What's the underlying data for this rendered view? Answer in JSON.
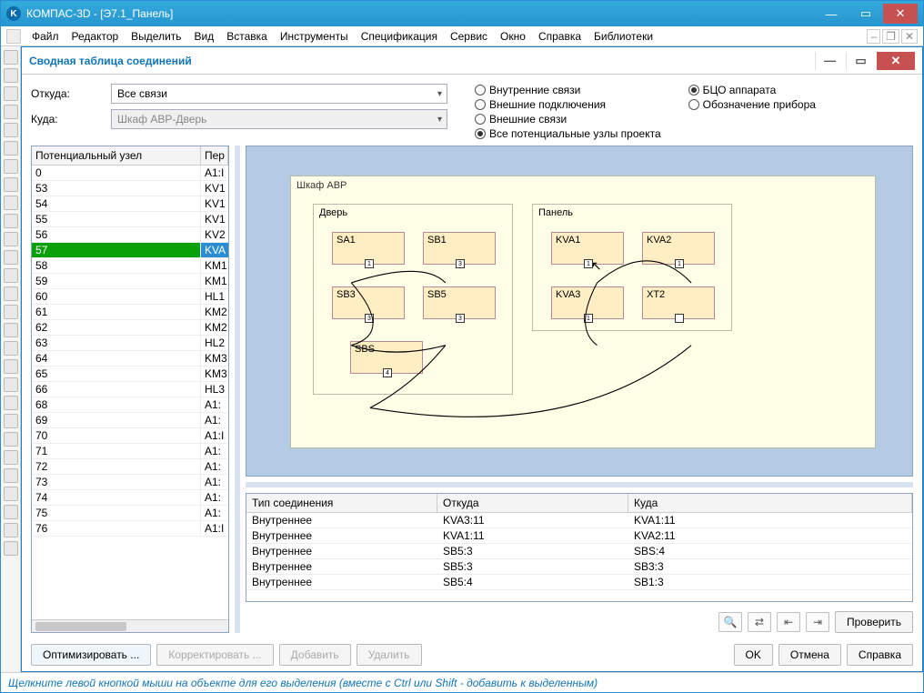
{
  "outer": {
    "app_icon": "K",
    "title": "КОМПАС-3D - [Э7.1_Панель]"
  },
  "menu": [
    "Файл",
    "Редактор",
    "Выделить",
    "Вид",
    "Вставка",
    "Инструменты",
    "Спецификация",
    "Сервис",
    "Окно",
    "Справка",
    "Библиотеки"
  ],
  "dialog": {
    "title": "Сводная таблица соединений",
    "from_label": "Откуда:",
    "to_label": "Куда:",
    "from_value": "Все связи",
    "to_value": "Шкаф АВР-Дверь",
    "radios1": [
      "Внутренние связи",
      "Внешние подключения",
      "Внешние связи",
      "Все потенциальные узлы проекта"
    ],
    "radios1_checked": 3,
    "radios2": [
      "БЦО аппарата",
      "Обозначение прибора"
    ],
    "radios2_checked": 0
  },
  "left_table": {
    "h1": "Потенциальный узел",
    "h2": "Пер",
    "rows": [
      {
        "a": "0",
        "b": "A1:I"
      },
      {
        "a": "53",
        "b": "KV1"
      },
      {
        "a": "54",
        "b": "KV1"
      },
      {
        "a": "55",
        "b": "KV1"
      },
      {
        "a": "56",
        "b": "KV2"
      },
      {
        "a": "57",
        "b": "KVA",
        "sel": true
      },
      {
        "a": "58",
        "b": "KM1"
      },
      {
        "a": "59",
        "b": "KM1"
      },
      {
        "a": "60",
        "b": "HL1"
      },
      {
        "a": "61",
        "b": "KM2"
      },
      {
        "a": "62",
        "b": "KM2"
      },
      {
        "a": "63",
        "b": "HL2"
      },
      {
        "a": "64",
        "b": "KM3"
      },
      {
        "a": "65",
        "b": "KM3"
      },
      {
        "a": "66",
        "b": "HL3"
      },
      {
        "a": "68",
        "b": "A1:"
      },
      {
        "a": "69",
        "b": "A1:"
      },
      {
        "a": "70",
        "b": "A1:I"
      },
      {
        "a": "71",
        "b": "A1:"
      },
      {
        "a": "72",
        "b": "A1:"
      },
      {
        "a": "73",
        "b": "A1:"
      },
      {
        "a": "74",
        "b": "A1:"
      },
      {
        "a": "75",
        "b": "A1:"
      },
      {
        "a": "76",
        "b": "A1:I"
      }
    ]
  },
  "diagram": {
    "cabinet": "Шкаф АВР",
    "group1": "Дверь",
    "group2": "Панель",
    "devices_left": [
      "SA1",
      "SB1",
      "SB3",
      "SB5",
      "SBS"
    ],
    "devices_right": [
      "KVA1",
      "KVA2",
      "KVA3",
      "XT2"
    ]
  },
  "conn_table": {
    "h1": "Тип соединения",
    "h2": "Откуда",
    "h3": "Куда",
    "rows": [
      {
        "t": "Внутреннее",
        "f": "KVA3:11",
        "to": "KVA1:11"
      },
      {
        "t": "Внутреннее",
        "f": "KVA1:11",
        "to": "KVA2:11"
      },
      {
        "t": "Внутреннее",
        "f": "SB5:3",
        "to": "SBS:4"
      },
      {
        "t": "Внутреннее",
        "f": "SB5:3",
        "to": "SB3:3"
      },
      {
        "t": "Внутреннее",
        "f": "SB5:4",
        "to": "SB1:3"
      }
    ]
  },
  "buttons": {
    "optimize": "Оптимизировать ...",
    "correct": "Корректировать ...",
    "add": "Добавить",
    "delete": "Удалить",
    "check": "Проверить",
    "ok": "OK",
    "cancel": "Отмена",
    "help": "Справка"
  },
  "status": "Щелкните левой кнопкой мыши на объекте для его выделения (вместе с Ctrl или Shift - добавить к выделенным)"
}
